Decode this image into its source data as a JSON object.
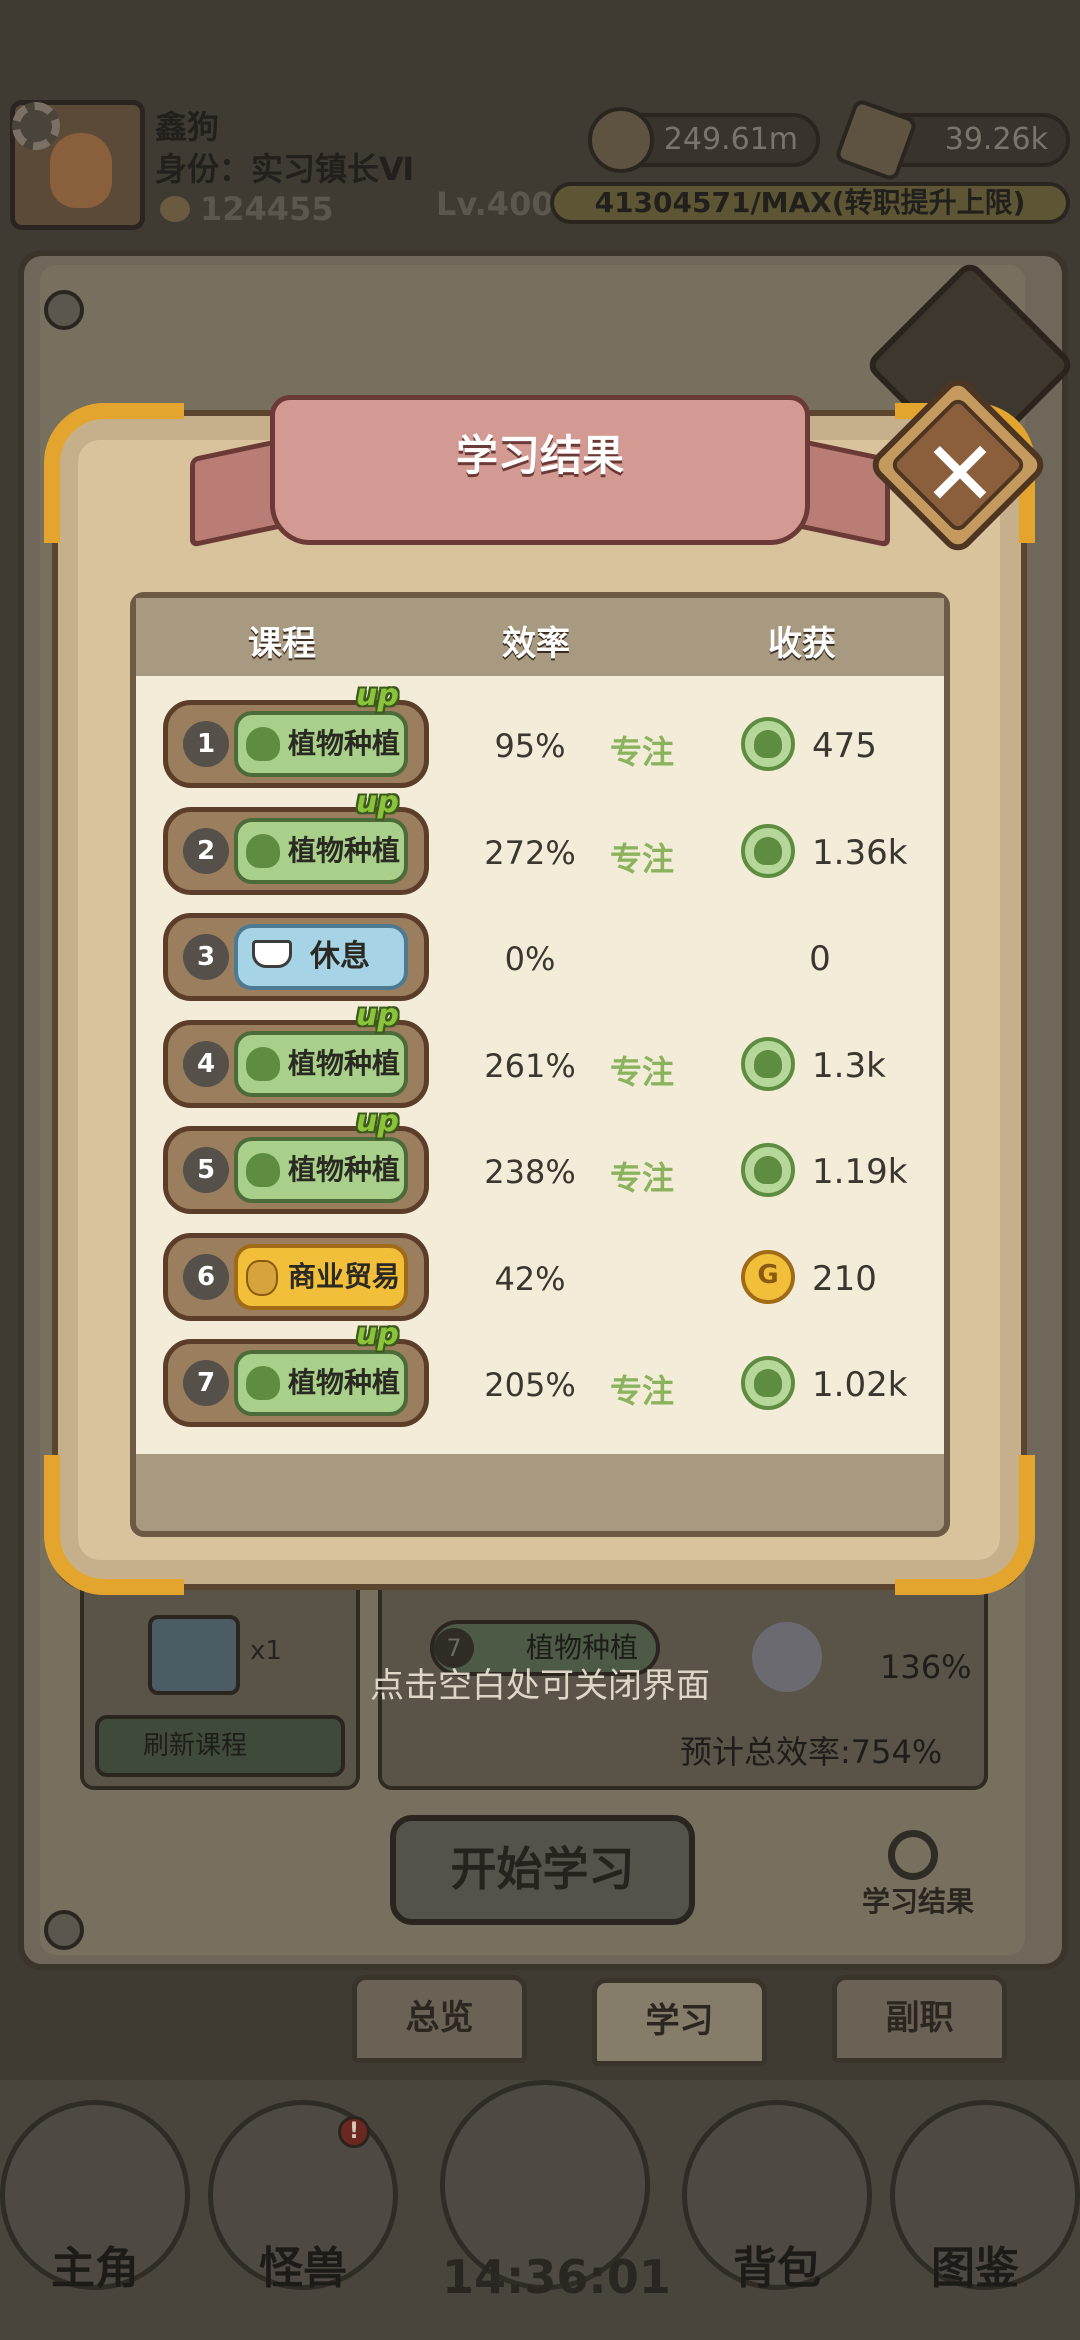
{
  "player": {
    "name": "鑫狗",
    "role": "身份：实习镇长Ⅵ",
    "coins": "124455",
    "currency1": "249.61m",
    "currency2": "39.26k",
    "level": "Lv.400",
    "exp": "41304571/MAX(转职提升上限)"
  },
  "popup": {
    "title": "学习结果",
    "close_icon": "close-x-icon",
    "headers": {
      "course": "课程",
      "efficiency": "效率",
      "gain": "收获"
    },
    "rows": [
      {
        "num": "1",
        "course": "植物种植",
        "type": "plant",
        "up": "up",
        "efficiency": "95%",
        "tag": "专注",
        "gain_icon": "leaf-icon",
        "gain": "475"
      },
      {
        "num": "2",
        "course": "植物种植",
        "type": "plant",
        "up": "up",
        "efficiency": "272%",
        "tag": "专注",
        "gain_icon": "leaf-icon",
        "gain": "1.36k"
      },
      {
        "num": "3",
        "course": "休息",
        "type": "rest",
        "up": "",
        "efficiency": "0%",
        "tag": "",
        "gain_icon": "",
        "gain": "0"
      },
      {
        "num": "4",
        "course": "植物种植",
        "type": "plant",
        "up": "up",
        "efficiency": "261%",
        "tag": "专注",
        "gain_icon": "leaf-icon",
        "gain": "1.3k"
      },
      {
        "num": "5",
        "course": "植物种植",
        "type": "plant",
        "up": "up",
        "efficiency": "238%",
        "tag": "专注",
        "gain_icon": "leaf-icon",
        "gain": "1.19k"
      },
      {
        "num": "6",
        "course": "商业贸易",
        "type": "trade",
        "up": "",
        "efficiency": "42%",
        "tag": "",
        "gain_icon": "gold-bag-icon",
        "gain": "210"
      },
      {
        "num": "7",
        "course": "植物种植",
        "type": "plant",
        "up": "up",
        "efficiency": "205%",
        "tag": "专注",
        "gain_icon": "leaf-icon",
        "gain": "1.02k"
      }
    ],
    "hint": "点击空白处可关闭界面"
  },
  "background": {
    "cup_count": "x1",
    "refresh_label": "刷新课程",
    "row7_num": "7",
    "row7_course": "植物种植",
    "row7_pct": "136%",
    "total_efficiency": "预计总效率:754%",
    "start_button": "开始学习",
    "results_link": "学习结果"
  },
  "tabs": {
    "overview": "总览",
    "study": "学习",
    "side_job": "副职"
  },
  "nav": {
    "hero": "主角",
    "monster": "怪兽",
    "backpack": "背包",
    "codex": "图鉴",
    "monster_badge": "!",
    "clock": "14:36:01"
  },
  "colors": {
    "plant_chip": "#a9d08a",
    "rest_chip": "#a7d3e6",
    "trade_chip": "#f2bf3a",
    "focus_text": "#8bb35e",
    "up_text": "#8bc43b",
    "corner_gold": "#e4a52e",
    "ribbon": "#d39a93"
  }
}
